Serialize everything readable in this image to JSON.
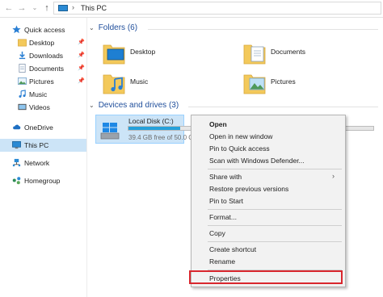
{
  "address": {
    "back_icon": "back-arrow-icon",
    "forward_icon": "forward-arrow-icon",
    "dropdown_icon": "chevron-down-icon",
    "up_icon": "up-arrow-icon",
    "separator": "›",
    "location": "This PC"
  },
  "sidebar": {
    "items": [
      {
        "label": "Quick access",
        "icon": "star-icon"
      },
      {
        "label": "Desktop",
        "icon": "desktop-folder-icon",
        "pinned": true
      },
      {
        "label": "Downloads",
        "icon": "downloads-icon",
        "pinned": true
      },
      {
        "label": "Documents",
        "icon": "documents-icon",
        "pinned": true
      },
      {
        "label": "Pictures",
        "icon": "pictures-icon",
        "pinned": true
      },
      {
        "label": "Music",
        "icon": "music-icon"
      },
      {
        "label": "Videos",
        "icon": "videos-icon"
      },
      {
        "label": "OneDrive",
        "icon": "cloud-icon"
      },
      {
        "label": "This PC",
        "icon": "computer-icon",
        "selected": true
      },
      {
        "label": "Network",
        "icon": "network-icon"
      },
      {
        "label": "Homegroup",
        "icon": "homegroup-icon"
      }
    ]
  },
  "folders": {
    "heading": "Folders (6)",
    "items": [
      {
        "label": "Desktop"
      },
      {
        "label": "Documents"
      },
      {
        "label": "Music"
      },
      {
        "label": "Pictures"
      }
    ]
  },
  "drives": {
    "heading": "Devices and drives (3)",
    "items": [
      {
        "name": "Local Disk (C:)",
        "free": "39.4 GB free of 50.0 GB",
        "used_fraction": 0.21
      }
    ]
  },
  "context_menu": {
    "items": [
      "Open",
      "Open in new window",
      "Pin to Quick access",
      "Scan with Windows Defender...",
      "Share with",
      "Restore previous versions",
      "Pin to Start",
      "Format...",
      "Copy",
      "Create shortcut",
      "Rename",
      "Properties"
    ]
  },
  "colors": {
    "accent": "#1f4e9b",
    "selection": "#cce4f7",
    "highlight_box": "#d9272e",
    "drive_bar": "#26a0da"
  }
}
